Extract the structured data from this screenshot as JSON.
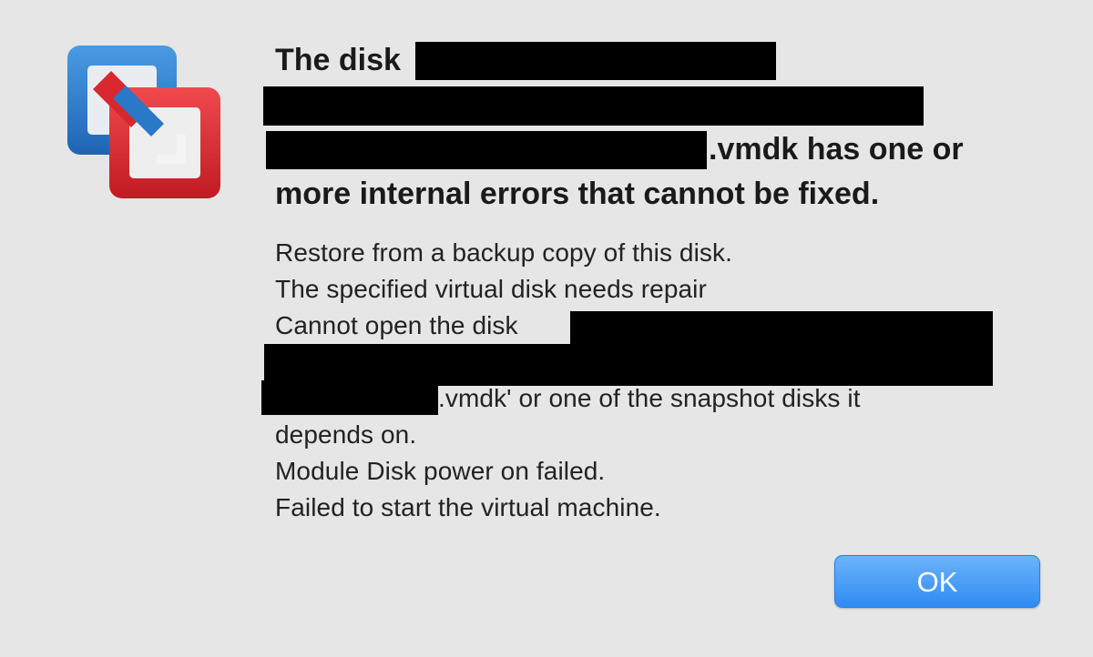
{
  "dialog": {
    "icon": "vmware-fusion-icon",
    "title": {
      "line1_prefix": "The disk",
      "line3_suffix": ".vmdk has one or",
      "line4": "more internal errors that cannot be fixed."
    },
    "message": {
      "line1": "Restore from a backup copy of this disk.",
      "line2": "The specified virtual disk needs repair",
      "line3_prefix": "Cannot open the disk",
      "line5_suffix": ".vmdk' or one of the snapshot disks it",
      "line6": "depends on.",
      "line7": "Module Disk power on failed.",
      "line8": "Failed to start the virtual machine."
    },
    "buttons": {
      "ok_label": "OK"
    },
    "colors": {
      "background": "#e6e6e6",
      "accent_blue": "#2f8cf3",
      "icon_blue": "#2a78c8",
      "icon_red": "#d8282e"
    }
  }
}
